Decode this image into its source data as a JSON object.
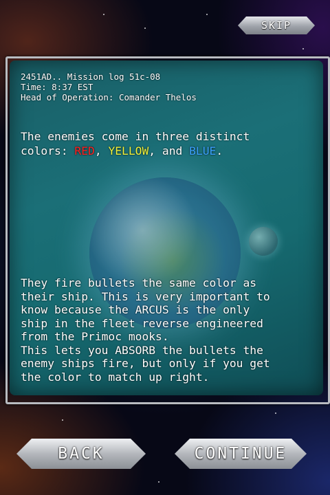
{
  "skip_label": "SKIP",
  "log_header_lines": [
    "2451AD.. Mission log 51c-08",
    "Time: 8:37 EST",
    "Head of Operation: Comander Thelos"
  ],
  "intro": {
    "line1": "The enemies come in three distinct",
    "line2_start": "colors: ",
    "red": "RED",
    "sep1": ", ",
    "yellow": "YELLOW",
    "sep2": ", and ",
    "blue": "BLUE",
    "end": "."
  },
  "body_lines": [
    "They fire bullets the same color as",
    "their ship. This is very important to",
    "know because the ARCUS is the only",
    "ship in the fleet reverse engineered",
    "from the Primoc mooks.",
    "This lets you ABSORB the bullets the",
    "enemy ships fire, but only if you get",
    "the color to match up right."
  ],
  "back_label": "BACK",
  "continue_label": "CONTINUE",
  "colors": {
    "red": "#ff2020",
    "yellow": "#f2f23a",
    "blue": "#3aa2ff",
    "panel": "#1b6f77"
  }
}
